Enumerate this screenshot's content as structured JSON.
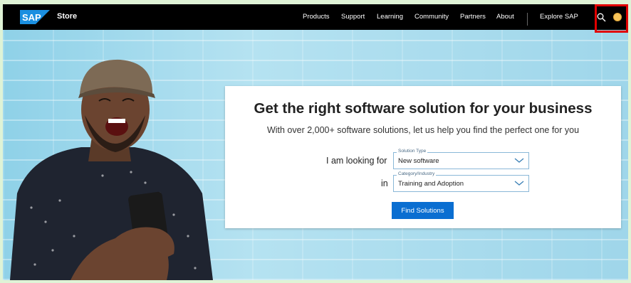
{
  "nav": {
    "brand": "SAP",
    "store": "Store",
    "items": [
      "Products",
      "Support",
      "Learning",
      "Community",
      "Partners",
      "About"
    ],
    "explore": "Explore SAP"
  },
  "hero": {
    "title": "Get the right software solution for your business",
    "subtitle": "With over 2,000+ software solutions, let us help you find the perfect one for you",
    "looking_label": "I am looking for",
    "in_label": "in",
    "solution_type": {
      "legend": "Solution Type",
      "value": "New software"
    },
    "category": {
      "legend": "Category/Industry",
      "value": "Training and Adoption"
    },
    "button": "Find Solutions"
  },
  "colors": {
    "nav_bg": "#000000",
    "accent": "#0a6ed1",
    "highlight": "#e10000"
  }
}
